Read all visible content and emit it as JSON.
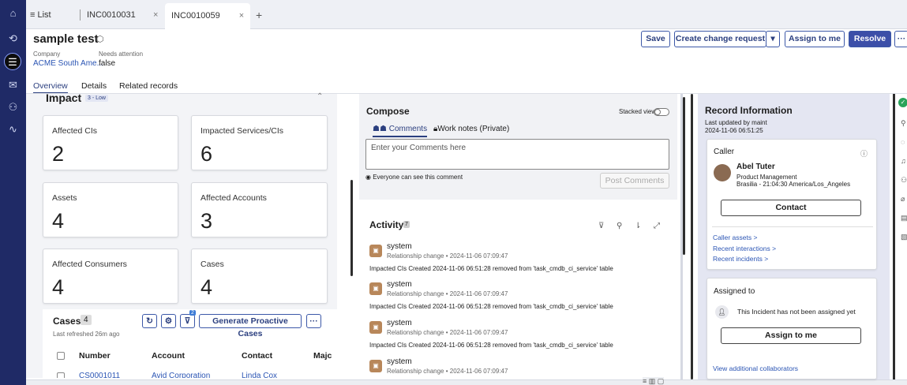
{
  "tabs": {
    "list_label": "List",
    "tab1": "INC0010031",
    "tab2": "INC0010059",
    "close": "×",
    "add": "+"
  },
  "header": {
    "title": "sample test",
    "company_label": "Company",
    "company_value": "ACME South Ame...",
    "attention_label": "Needs attention",
    "attention_value": "false",
    "save": "Save",
    "create_change": "Create change request",
    "assign_to_me": "Assign to me",
    "resolve": "Resolve",
    "more": "···"
  },
  "subnav": {
    "overview": "Overview",
    "details": "Details",
    "related": "Related records"
  },
  "impact": {
    "title": "Impact",
    "badge": "3 - Low",
    "cards": [
      {
        "label": "Affected CIs",
        "value": "2"
      },
      {
        "label": "Impacted Services/CIs",
        "value": "6"
      },
      {
        "label": "Assets",
        "value": "4"
      },
      {
        "label": "Affected Accounts",
        "value": "3"
      },
      {
        "label": "Affected Consumers",
        "value": "4"
      },
      {
        "label": "Cases",
        "value": "4"
      }
    ]
  },
  "cases": {
    "title": "Cases",
    "count": "4",
    "refreshed": "Last refreshed 26m ago",
    "filter_badge": "2",
    "generate": "Generate Proactive Cases",
    "more": "···",
    "columns": [
      "Number",
      "Account",
      "Contact",
      "Majc"
    ],
    "row1": [
      "CS0001011",
      "Avid Corporation",
      "Linda Cox"
    ]
  },
  "compose": {
    "title": "Compose",
    "stacked": "Stacked view",
    "tab_comments": "Comments",
    "tab_worknotes": "Work notes (Private)",
    "placeholder": "Enter your Comments here",
    "visibility": "Everyone can see this comment",
    "post": "Post Comments"
  },
  "activity": {
    "title": "Activity",
    "count": "7",
    "items": [
      {
        "user": "system",
        "meta": "Relationship change • 2024-11-06 07:09:47",
        "text": "Impacted CIs Created 2024-11-06 06:51:28 removed from 'task_cmdb_ci_service' table"
      },
      {
        "user": "system",
        "meta": "Relationship change • 2024-11-06 07:09:47",
        "text": "Impacted CIs Created 2024-11-06 06:51:28 removed from 'task_cmdb_ci_service' table"
      },
      {
        "user": "system",
        "meta": "Relationship change • 2024-11-06 07:09:47",
        "text": "Impacted CIs Created 2024-11-06 06:51:28 removed from 'task_cmdb_ci_service' table"
      },
      {
        "user": "system",
        "meta": "Relationship change • 2024-11-06 07:09:47",
        "text": ""
      }
    ]
  },
  "record": {
    "title": "Record Information",
    "updated": "Last updated by maint",
    "updated_date": "2024-11-06 06:51:25",
    "caller_label": "Caller",
    "caller_name": "Abel Tuter",
    "caller_dept": "Product Management",
    "caller_loc": "Brasilia - 21:04:30 America/Los_Angeles",
    "contact": "Contact",
    "links": [
      "Caller assets >",
      "Recent interactions >",
      "Recent incidents >"
    ],
    "assigned_label": "Assigned to",
    "assigned_text": "This Incident has not been assigned yet",
    "assign_btn": "Assign to me",
    "view_collab": "View additional collaborators"
  },
  "colors": {
    "rail": "#1f2a66",
    "accent": "#3c4fa8",
    "link": "#2b55b4",
    "activity_bg": "#f1f2f5"
  }
}
